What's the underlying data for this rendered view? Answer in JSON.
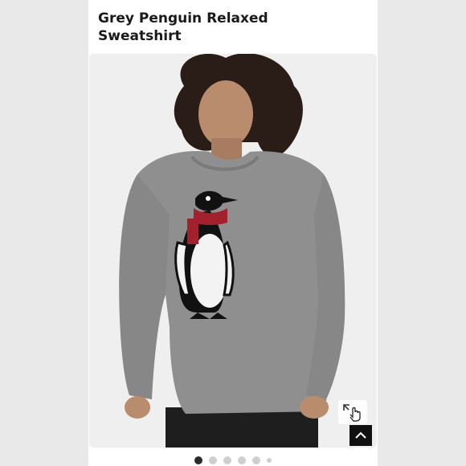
{
  "product": {
    "title": "Grey Penguin Relaxed Sweatshirt"
  },
  "carousel": {
    "slide_count": 6,
    "active_index": 0
  },
  "icons": {
    "zoom": "expand-hand-icon",
    "scroll_top": "chevron-up-icon"
  },
  "colors": {
    "sweater": "#8f8f8f",
    "scarf": "#a3202e",
    "dot_active": "#2b2b2b",
    "dot_inactive": "#cfcfcf"
  }
}
